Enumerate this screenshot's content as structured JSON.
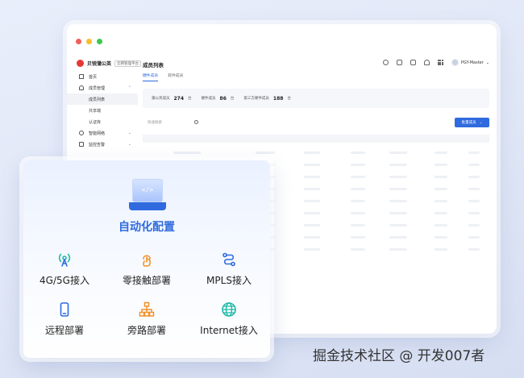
{
  "window": {
    "brand": {
      "name": "贝锐蒲公英",
      "tag": "云网管理平台"
    },
    "page_title": "成员列表",
    "topbar": {
      "user": "PGY-Master",
      "user_chevron": "⌄"
    },
    "tabs": [
      {
        "label": "硬件成员",
        "active": true
      },
      {
        "label": "软件成员",
        "active": false
      }
    ],
    "sidebar": {
      "items": [
        {
          "label": "首页",
          "icon": "home-icon"
        },
        {
          "label": "成员管理",
          "icon": "user-icon",
          "chevron": "⌃"
        },
        {
          "label": "成员列表",
          "sub": true,
          "active": true
        },
        {
          "label": "共享端",
          "sub": true
        },
        {
          "label": "认证库",
          "sub": true
        },
        {
          "label": "智能网络",
          "icon": "gear-icon",
          "chevron": "⌄"
        },
        {
          "label": "监控告警",
          "icon": "monitor-icon",
          "chevron": "⌄"
        }
      ]
    },
    "stats": [
      {
        "label": "蒲公英成员",
        "value": "274",
        "unit": "台"
      },
      {
        "label": "硬件成员",
        "value": "86",
        "unit": "台"
      },
      {
        "label": "第三方硬件成员",
        "value": "188",
        "unit": "台"
      }
    ],
    "search": {
      "placeholder": "快速搜索"
    },
    "add_button": {
      "label": "批量成员",
      "chevron": "⌄"
    }
  },
  "card": {
    "code_glyph": "</>",
    "title": "自动化配置",
    "features": [
      {
        "label": "4G/5G接入",
        "icon": "signal-tower-icon"
      },
      {
        "label": "零接触部署",
        "icon": "touch-icon"
      },
      {
        "label": "MPLS接入",
        "icon": "route-icon"
      },
      {
        "label": "远程部署",
        "icon": "mobile-icon"
      },
      {
        "label": "旁路部署",
        "icon": "org-chart-icon"
      },
      {
        "label": "Internet接入",
        "icon": "globe-icon"
      }
    ]
  },
  "watermark": "掘金技术社区 @ 开发007者",
  "colors": {
    "accent": "#2f6bde",
    "teal": "#1fb8a6",
    "orange": "#f0922b"
  }
}
